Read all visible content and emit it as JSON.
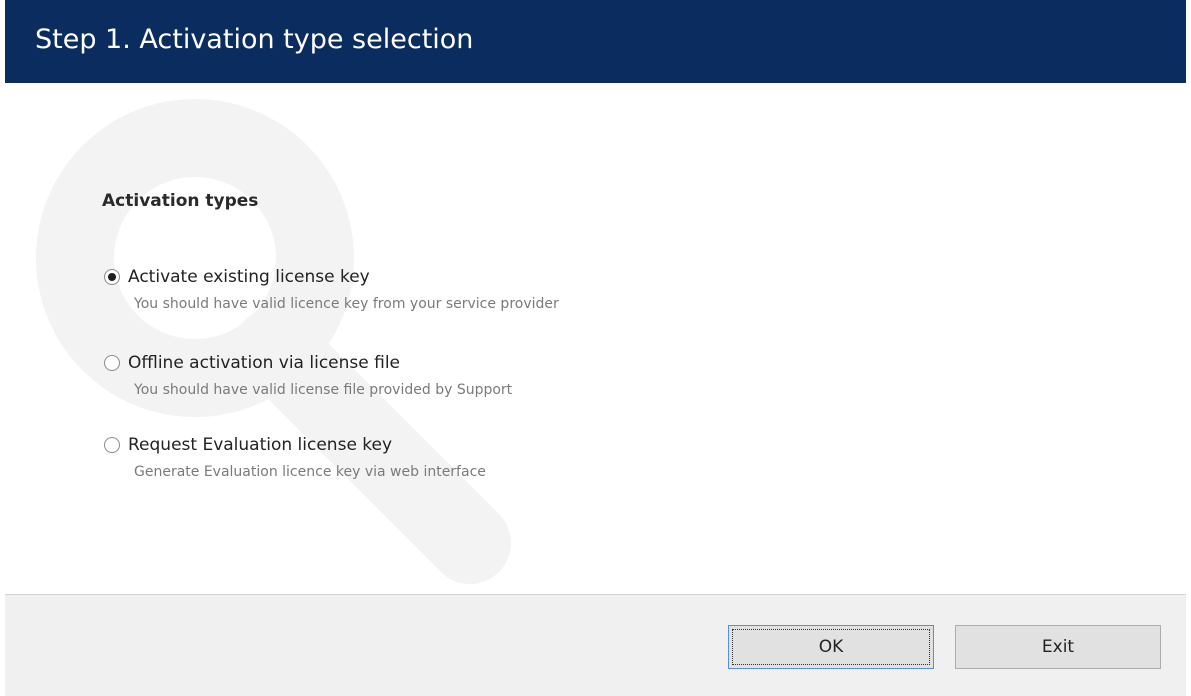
{
  "header": {
    "title": "Step 1. Activation type selection"
  },
  "content": {
    "section_title": "Activation types",
    "watermark_icon": "key-icon",
    "options": [
      {
        "label": "Activate existing license key",
        "description": "You should have valid licence key from your service provider",
        "checked": true
      },
      {
        "label": "Offline activation via license file",
        "description": "You should have valid license file provided by Support",
        "checked": false
      },
      {
        "label": "Request Evaluation license key",
        "description": "Generate Evaluation licence key via web interface",
        "checked": false
      }
    ]
  },
  "footer": {
    "ok_label": "OK",
    "exit_label": "Exit"
  },
  "colors": {
    "header_bg": "#0b2c5f",
    "footer_bg": "#f0f0f0",
    "focus_border": "#5b8ed8"
  }
}
